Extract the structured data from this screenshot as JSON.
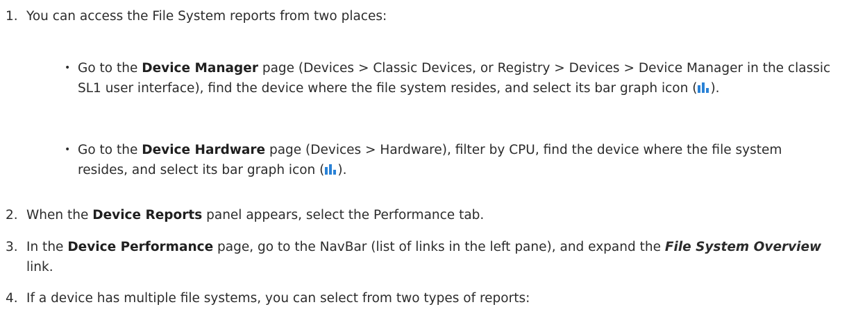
{
  "steps": [
    {
      "num": "1.",
      "text": "You can access the File System reports from two places:",
      "bullets": [
        {
          "pre": "Go to the ",
          "bold": "Device Manager",
          "post": " page (Devices > Classic Devices, or Registry > Devices > Device Manager in the classic SL1 user interface), find the device where the file system resides, and select its bar graph icon (",
          "end": ")."
        },
        {
          "pre": "Go to the ",
          "bold": "Device Hardware",
          "post": " page (Devices > Hardware), filter by CPU, find the device where the file system resides, and select its bar graph icon (",
          "end": ")."
        }
      ]
    },
    {
      "num": "2.",
      "pre": "When the ",
      "bold": "Device Reports",
      "post": " panel appears, select the Performance tab."
    },
    {
      "num": "3.",
      "pre": "In the ",
      "bold": "Device Performance",
      "mid": " page, go to the NavBar (list of links in the left pane), and expand the ",
      "bold_italic": "File System Overview",
      "post": " link."
    },
    {
      "num": "4.",
      "text": "If a device has multiple file systems, you can select from two types of reports:"
    }
  ],
  "icons": {
    "bar_graph": "bar-graph-icon",
    "bar_color": "#2a82d6"
  }
}
